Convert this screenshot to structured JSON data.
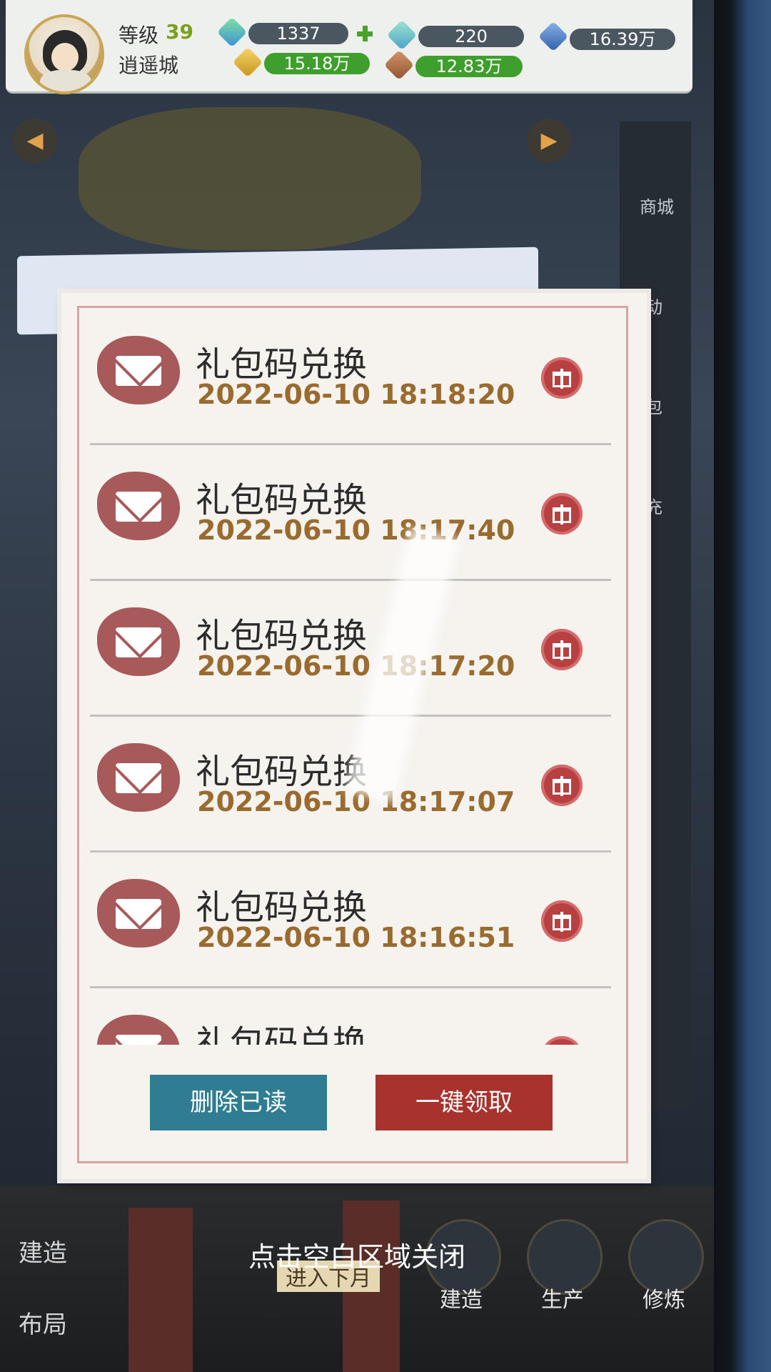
{
  "header": {
    "level_label": "等级",
    "level_value": "39",
    "city_name": "逍遥城",
    "resources": {
      "gem": "1337",
      "jade": "220",
      "crystal": "16.39万",
      "gold": "15.18万",
      "food": "12.83万"
    }
  },
  "scene": {
    "side_labels": [
      "商城",
      "动",
      "包",
      "充"
    ]
  },
  "mailbox": {
    "items": [
      {
        "title": "礼包码兑换",
        "time": "2022-06-10 18:18:20"
      },
      {
        "title": "礼包码兑换",
        "time": "2022-06-10 18:17:40"
      },
      {
        "title": "礼包码兑换",
        "time": "2022-06-10 18:17:20"
      },
      {
        "title": "礼包码兑换",
        "time": "2022-06-10 18:17:07"
      },
      {
        "title": "礼包码兑换",
        "time": "2022-06-10 18:16:51"
      },
      {
        "title": "礼包码兑换",
        "time": ""
      }
    ],
    "delete_read_label": "删除已读",
    "claim_all_label": "一键领取"
  },
  "close_hint": "点击空白区域关闭",
  "bottom_menu": {
    "left_items": [
      "建造",
      "布局"
    ],
    "items": [
      "建造",
      "生产",
      "修炼"
    ],
    "partial_sign": "进入下月"
  },
  "colors": {
    "accent_red": "#a8322c",
    "accent_teal": "#2e7d92",
    "time_brown": "#9a6b2f"
  }
}
